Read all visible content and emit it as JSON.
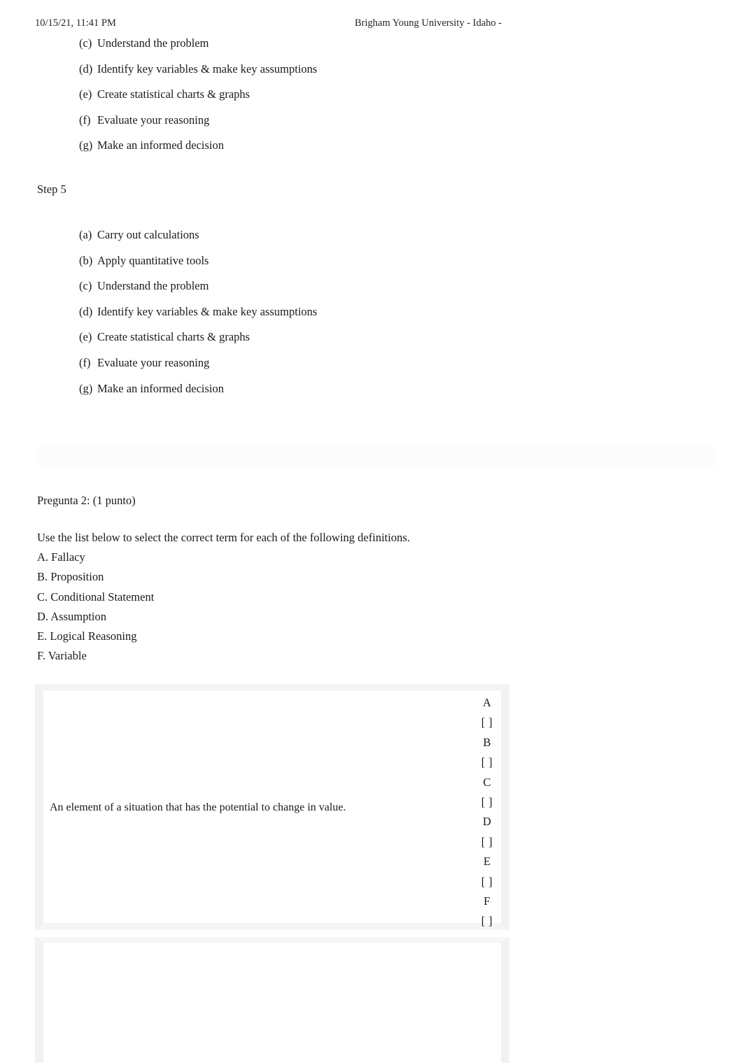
{
  "header": {
    "timestamp": "10/15/21, 11:41 PM",
    "institution": "Brigham Young University - Idaho -"
  },
  "step4_options": [
    {
      "marker": "(c)",
      "text": "Understand the problem"
    },
    {
      "marker": "(d)",
      "text": "Identify key variables & make key assumptions"
    },
    {
      "marker": "(e)",
      "text": "Create statistical charts & graphs"
    },
    {
      "marker": "(f)",
      "text": "Evaluate your reasoning"
    },
    {
      "marker": "(g)",
      "text": "Make an informed decision"
    }
  ],
  "step5": {
    "label": "Step 5",
    "options": [
      {
        "marker": "(a)",
        "text": "Carry out calculations"
      },
      {
        "marker": "(b)",
        "text": "Apply quantitative tools"
      },
      {
        "marker": "(c)",
        "text": "Understand the problem"
      },
      {
        "marker": "(d)",
        "text": "Identify key variables & make key assumptions"
      },
      {
        "marker": "(e)",
        "text": "Create statistical charts & graphs"
      },
      {
        "marker": "(f)",
        "text": "Evaluate your reasoning"
      },
      {
        "marker": "(g)",
        "text": "Make an informed decision"
      }
    ]
  },
  "question2": {
    "title": "Pregunta 2: (1 punto)",
    "prompt": "Use the list below to select the correct term for each of the following definitions.",
    "terms": [
      "A. Fallacy",
      "B. Proposition",
      "C. Conditional Statement",
      "D. Assumption",
      "E. Logical Reasoning",
      "F. Variable"
    ],
    "matching_rows": [
      {
        "definition": "An element of a situation that has the potential to change in value.",
        "choices": [
          {
            "letter": "A",
            "box": "[ ]"
          },
          {
            "letter": "B",
            "box": "[ ]"
          },
          {
            "letter": "C",
            "box": "[ ]"
          },
          {
            "letter": "D",
            "box": "[ ]"
          },
          {
            "letter": "E",
            "box": "[ ]"
          },
          {
            "letter": "F",
            "box": "[ ]"
          }
        ]
      }
    ]
  }
}
